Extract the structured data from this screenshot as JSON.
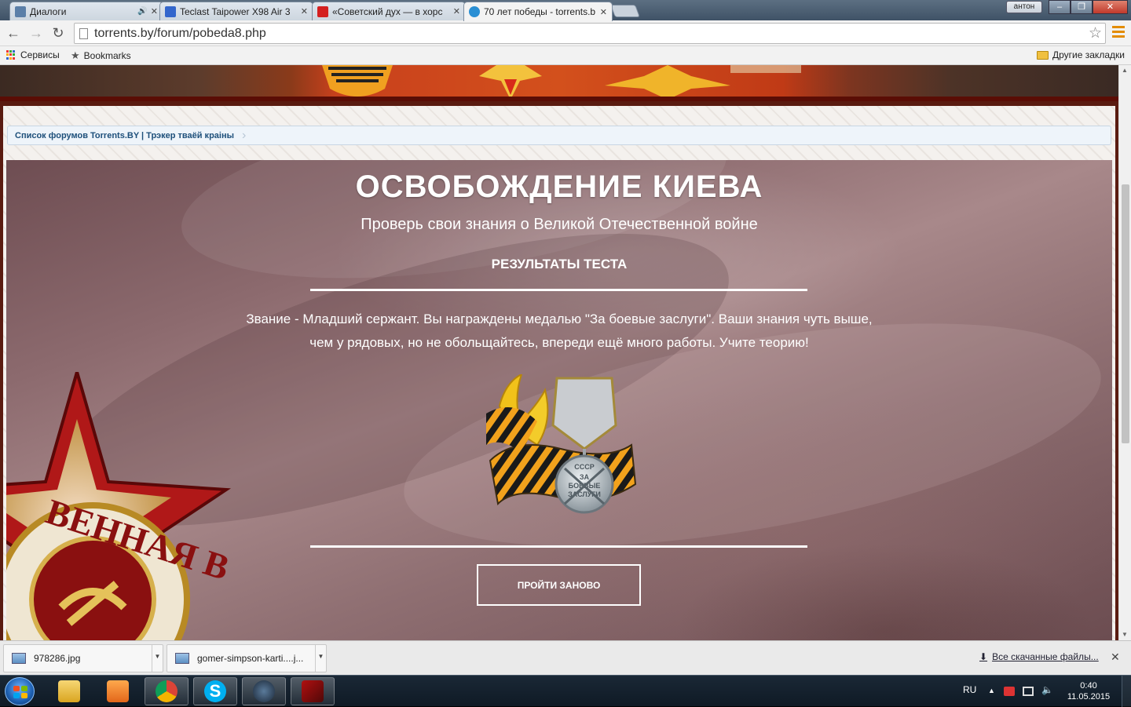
{
  "tabs": [
    {
      "title": "Диалоги",
      "fav_color": "#5b7fa8",
      "audio": true
    },
    {
      "title": "Teclast Taipower X98 Air 3",
      "fav_color": "#3366cc"
    },
    {
      "title": "«Советский дух — в хорс",
      "fav_color": "#d42020"
    },
    {
      "title": "70 лет победы - torrents.b",
      "fav_color": "#2a8fd4",
      "active": true
    }
  ],
  "window": {
    "profile_name": "антон"
  },
  "toolbar": {
    "url": "torrents.by/forum/pobeda8.php"
  },
  "bookmarks": {
    "apps": "Сервисы",
    "bookmarks": "Bookmarks",
    "other": "Другие закладки"
  },
  "breadcrumb": {
    "text": "Список форумов Torrents.BY | Трэкер тваёй краіны"
  },
  "quiz": {
    "title": "ОСВОБОЖДЕНИЕ КИЕВА",
    "subtitle": "Проверь свои знания о Великой Отечественной войне",
    "results_heading": "РЕЗУЛЬТАТЫ ТЕСТА",
    "result_message": "Звание - Младший сержант. Вы награждены медалью \"За боевые заслуги\". Ваши знания чуть выше, чем у рядовых, но не обольщайтесь, впереди ещё много работы. Учите теорию!",
    "retry_label": "ПРОЙТИ ЗАНОВО",
    "medal_text_top": "СССР",
    "medal_text_1": "ЗА",
    "medal_text_2": "БОЕВЫЕ",
    "medal_text_3": "ЗАСЛУГИ",
    "order_text": "ВЕННАЯ В"
  },
  "downloads": {
    "items": [
      {
        "name": "978286.jpg"
      },
      {
        "name": "gomer-simpson-karti....j..."
      }
    ],
    "show_all": "Все скачанные файлы..."
  },
  "taskbar": {
    "language": "RU",
    "time": "0:40",
    "date": "11.05.2015"
  },
  "colors": {
    "accent_orange": "#e38c00",
    "banner_red": "#c8401c",
    "breadcrumb_link": "#1d4f7a"
  }
}
